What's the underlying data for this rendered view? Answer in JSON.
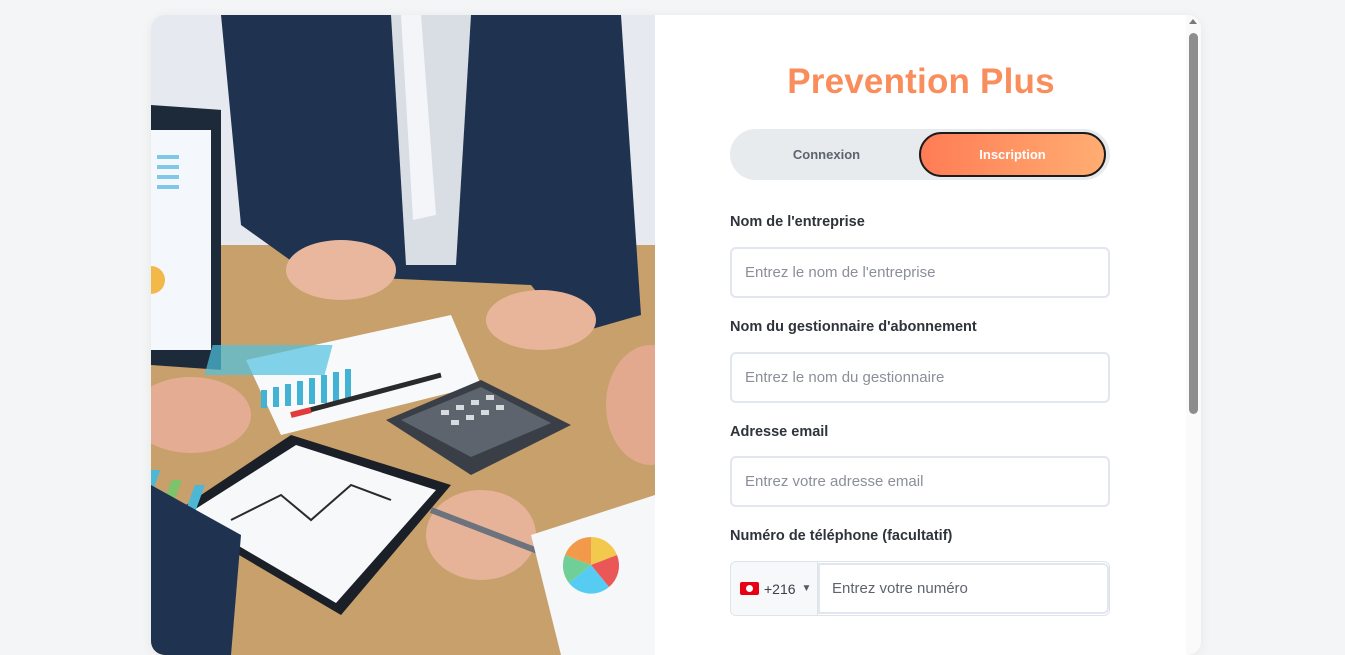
{
  "brand": {
    "title": "Prevention Plus"
  },
  "tabs": {
    "login": "Connexion",
    "signup": "Inscription",
    "active": "signup"
  },
  "form": {
    "company": {
      "label": "Nom de l'entreprise",
      "placeholder": "Entrez le nom de l'entreprise",
      "value": ""
    },
    "manager": {
      "label": "Nom du gestionnaire d'abonnement",
      "placeholder": "Entrez le nom du gestionnaire",
      "value": ""
    },
    "email": {
      "label": "Adresse email",
      "placeholder": "Entrez votre adresse email",
      "value": ""
    },
    "phone": {
      "label": "Numéro de téléphone (facultatif)",
      "country_code": "+216",
      "flag_icon": "tunisia-flag-icon",
      "placeholder": "Entrez votre numéro",
      "value": ""
    }
  },
  "colors": {
    "brand": "#f98d5c",
    "tab_gradient_start": "#ff7c55",
    "tab_gradient_end": "#ffad72",
    "tab_track": "#e8ebee"
  }
}
